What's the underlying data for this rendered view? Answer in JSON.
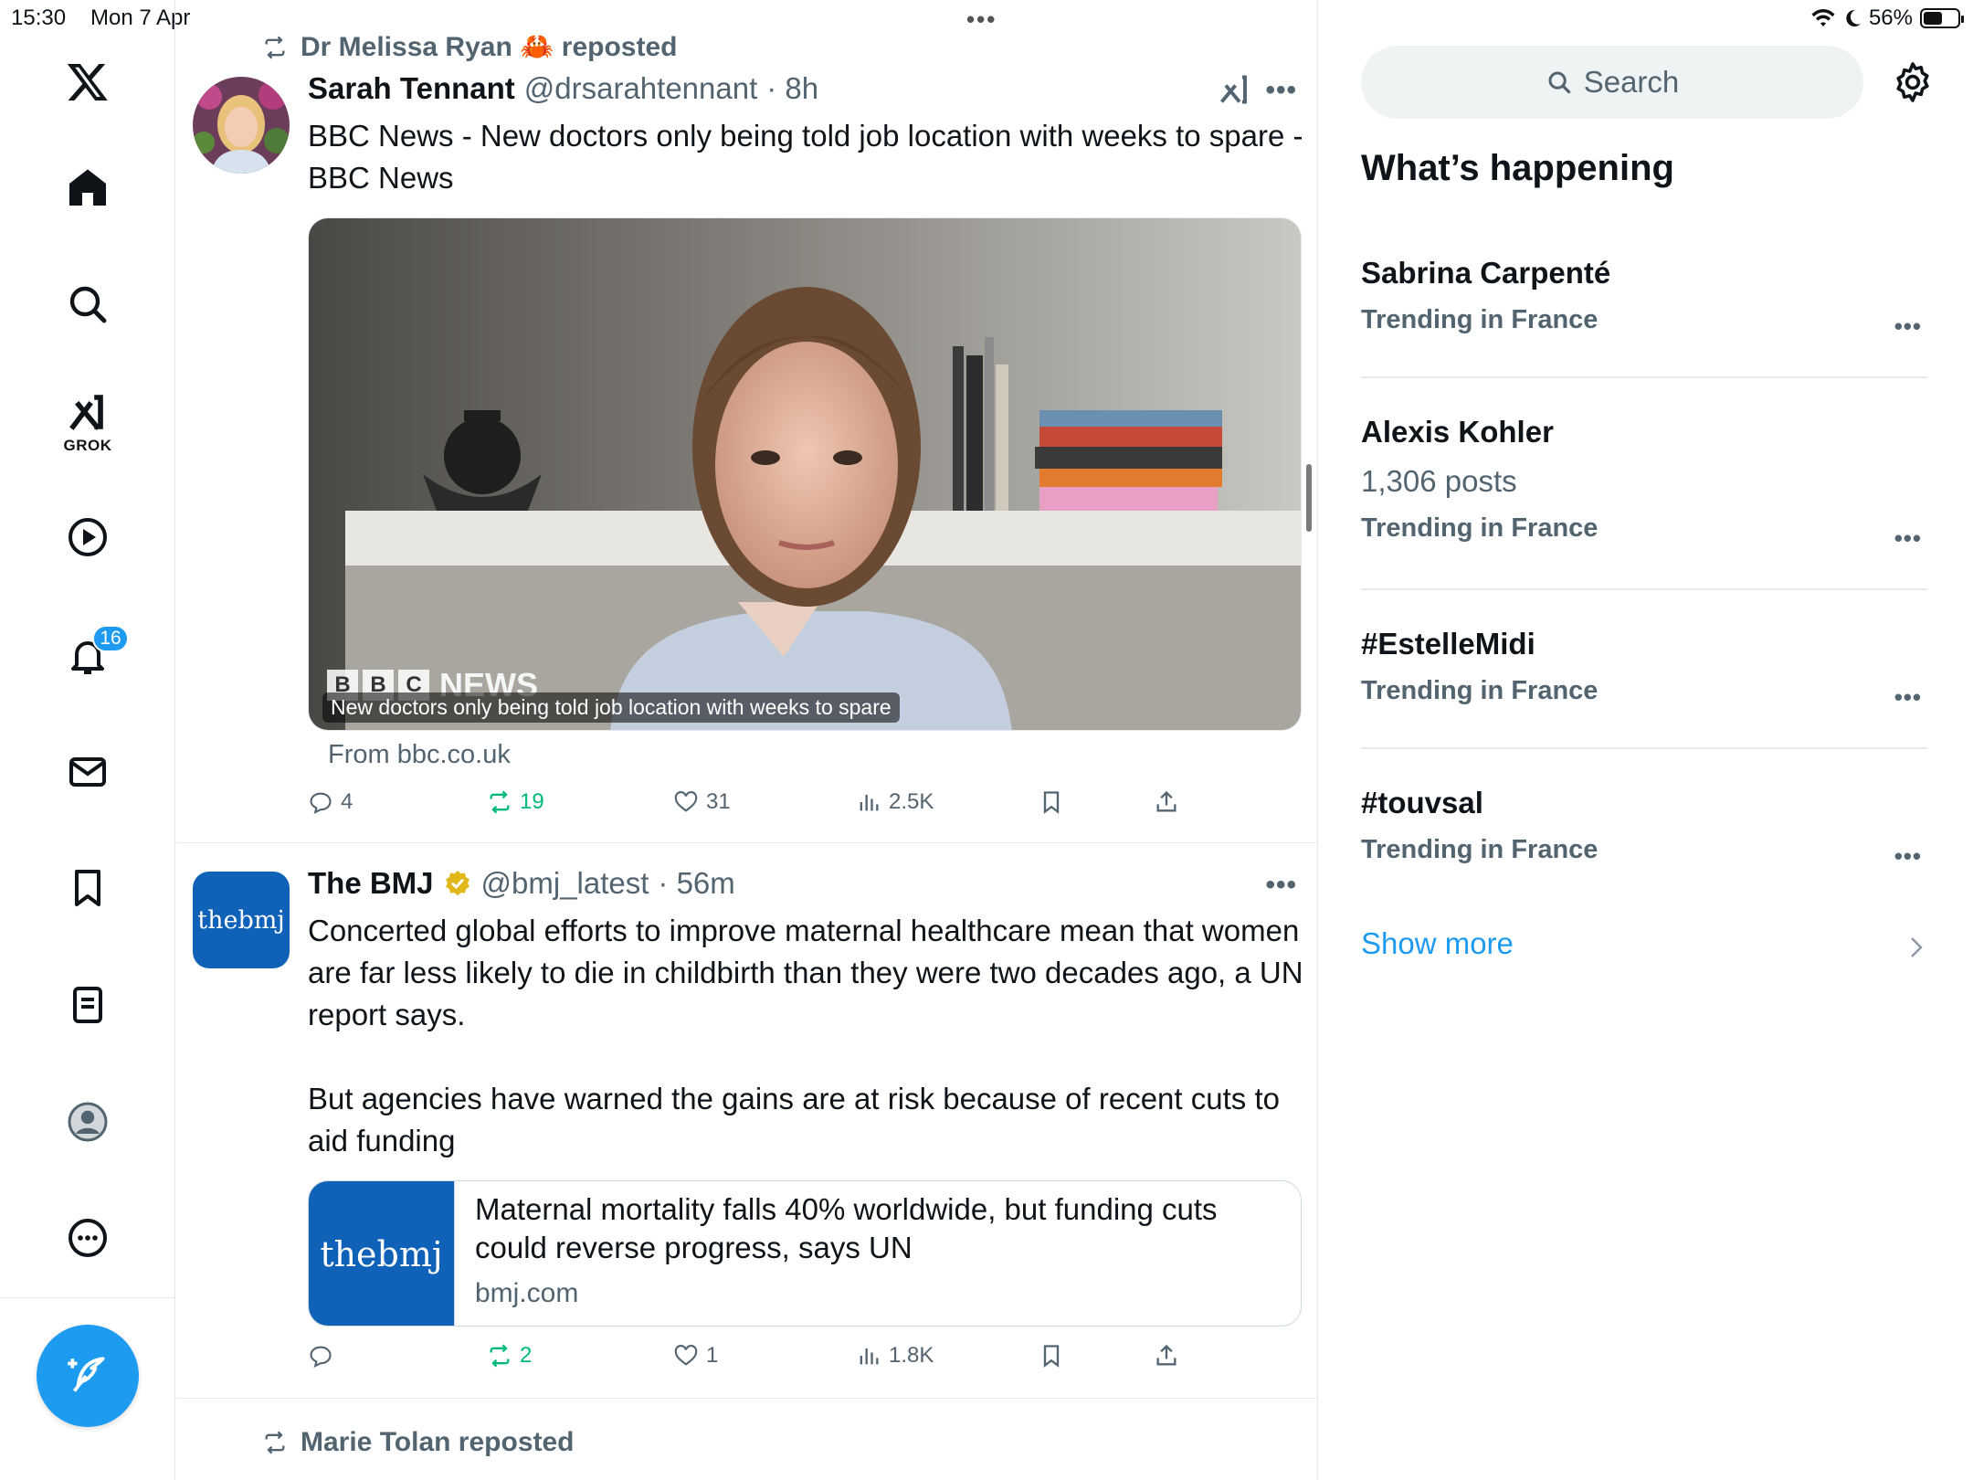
{
  "status_bar": {
    "time": "15:30",
    "date": "Mon 7 Apr",
    "battery": "56%",
    "battery_level": 0.56
  },
  "nav": {
    "grok_label": "GROK",
    "notifications_count": "16",
    "icons": [
      "x-logo-icon",
      "home-icon",
      "search-icon",
      "grok-icon",
      "video-icon",
      "bell-icon",
      "mail-icon",
      "bookmark-icon",
      "lists-icon",
      "profile-icon",
      "more-icon",
      "compose-icon"
    ]
  },
  "posts": [
    {
      "repost_by": "Dr Melissa Ryan 🦀 reposted",
      "name": "Sarah Tennant",
      "handle": "@drsarahtennant",
      "time": "· 8h",
      "text": "BBC News - New doctors only being told job location with weeks to spare - BBC News",
      "media_caption": "New doctors only being told job location with weeks to spare",
      "media_logo": [
        "B",
        "B",
        "C"
      ],
      "media_logo_word": "NEWS",
      "from": "From bbc.co.uk",
      "replies": "4",
      "reposts": "19",
      "likes": "31",
      "views": "2.5K"
    },
    {
      "name": "The BMJ",
      "handle": "@bmj_latest",
      "time": "· 56m",
      "avatar_text": "thebmj",
      "text_1": "Concerted global efforts to improve maternal healthcare mean that women are far less likely to die in childbirth than they were two decades ago, a UN report says.",
      "text_2": "But agencies have warned the gains are at risk because of recent cuts to aid funding",
      "card_thumb": "thebmj",
      "card_title": "Maternal mortality falls 40% worldwide, but funding cuts could reverse progress, says UN",
      "card_domain": "bmj.com",
      "replies": "",
      "reposts": "2",
      "likes": "1",
      "views": "1.8K"
    },
    {
      "repost_by": "Marie Tolan reposted"
    }
  ],
  "sidebar": {
    "search_placeholder": "Search",
    "title": "What’s happening",
    "trends": [
      {
        "name": "Sabrina Carpenté",
        "posts": "",
        "context": "Trending in France"
      },
      {
        "name": "Alexis Kohler",
        "posts": "1,306 posts",
        "context": "Trending in France"
      },
      {
        "name": "#EstelleMidi",
        "posts": "",
        "context": "Trending in France"
      },
      {
        "name": "#touvsal",
        "posts": "",
        "context": "Trending in France"
      }
    ],
    "show_more": "Show more"
  },
  "colors": {
    "accent": "#1d9bf0",
    "repost_green": "#00ba7c",
    "muted": "#536471",
    "bmj_blue": "#0f62b8"
  }
}
